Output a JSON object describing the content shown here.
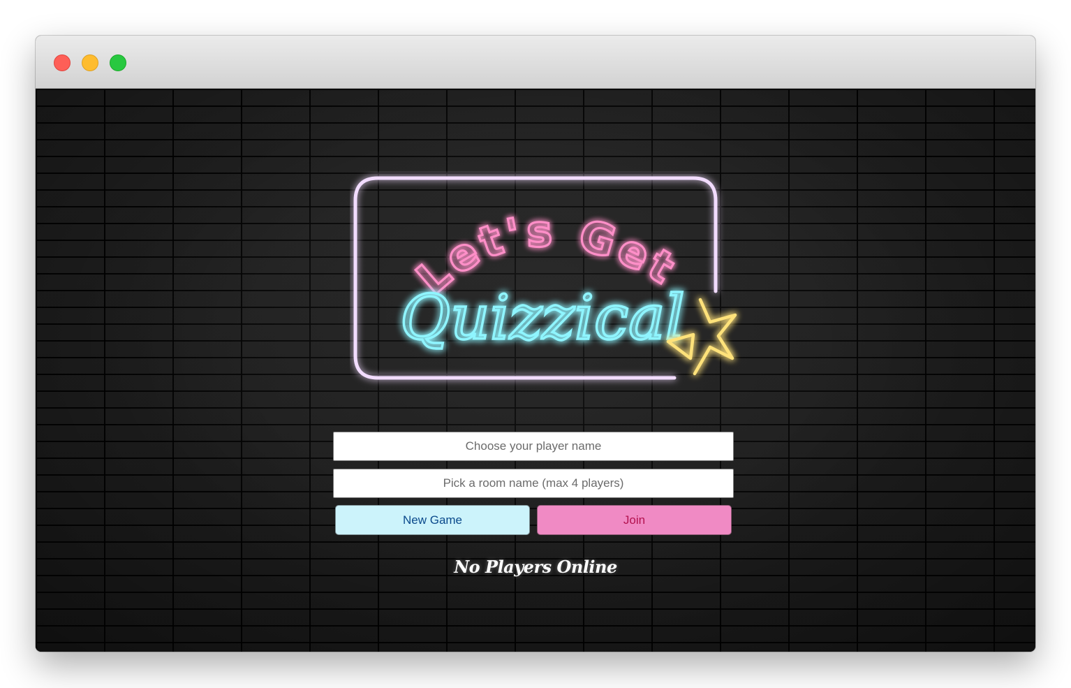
{
  "window": {
    "controls": [
      "close",
      "minimize",
      "maximize"
    ]
  },
  "logo": {
    "line1": "Let's Get",
    "line2": "Quizzical",
    "colors": {
      "frame": "#f2dcff",
      "line1": "#ff8fc8",
      "line2": "#8ff5ff",
      "star": "#ffe27a"
    },
    "icon": "star-icon"
  },
  "form": {
    "player_name": {
      "placeholder": "Choose your player name",
      "value": ""
    },
    "room_name": {
      "placeholder": "Pick a room name (max 4 players)",
      "value": ""
    },
    "new_game_label": "New Game",
    "join_label": "Join"
  },
  "status": {
    "text": "No Players Online"
  },
  "theme": {
    "background": "#161616",
    "new_game_bg": "#ccf3fb",
    "new_game_text": "#0b4a8c",
    "join_bg": "#f08ac4",
    "join_text": "#b3124f"
  }
}
